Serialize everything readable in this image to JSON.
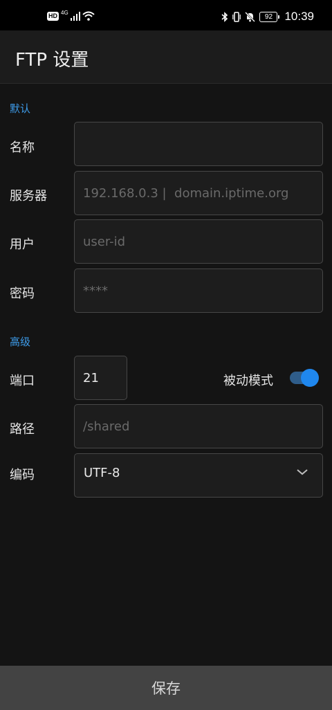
{
  "status_bar": {
    "hd": "HD",
    "network": "4G",
    "battery": "92",
    "time": "10:39"
  },
  "app_bar": {
    "title": "FTP 设置"
  },
  "sections": {
    "default": "默认",
    "advanced": "高级"
  },
  "fields": {
    "name": {
      "label": "名称",
      "value": "",
      "placeholder": ""
    },
    "server": {
      "label": "服务器",
      "value": "",
      "placeholder": "192.168.0.3 |  domain.iptime.org"
    },
    "user": {
      "label": "用户",
      "value": "",
      "placeholder": "user-id"
    },
    "password": {
      "label": "密码",
      "value": "",
      "placeholder": "****"
    },
    "port": {
      "label": "端口",
      "value": "21"
    },
    "path": {
      "label": "路径",
      "value": "",
      "placeholder": "/shared"
    },
    "encoding": {
      "label": "编码",
      "value": "UTF-8"
    }
  },
  "passive_mode": {
    "label": "被动模式",
    "enabled": true
  },
  "save_button": {
    "label": "保存"
  },
  "colors": {
    "accent": "#3d9be9",
    "toggle_on": "#1f87ee",
    "background": "#141414"
  }
}
